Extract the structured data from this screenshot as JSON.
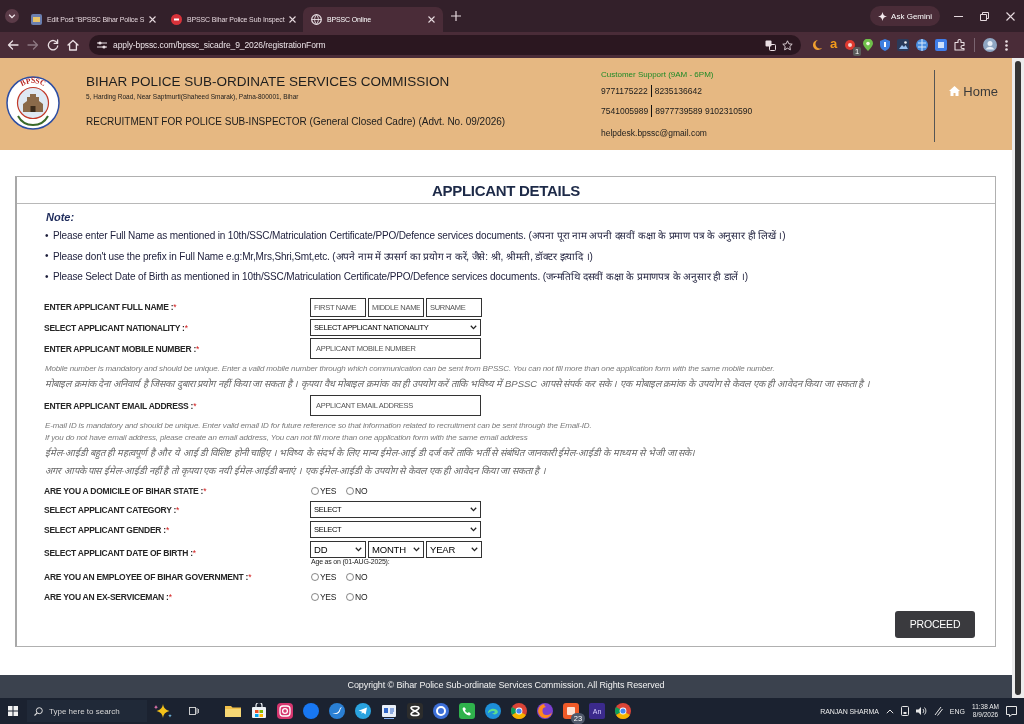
{
  "browser": {
    "tabs": [
      {
        "title": "Edit Post “BPSSC Bihar Police S",
        "selected": false
      },
      {
        "title": "BPSSC Bihar Police Sub Inspect",
        "selected": false
      },
      {
        "title": "BPSSC Online",
        "selected": true
      }
    ],
    "ask_gemini": "Ask Gemini",
    "url": "apply-bpssc.com/bpssc_sicadre_9_2026/registrationForm",
    "extension_letter": "a",
    "extension_badge": "1"
  },
  "header": {
    "logo_text": "BPSSC",
    "org_name": "BIHAR POLICE SUB-ORDINATE SERVICES COMMISSION",
    "address": "5, Harding Road, Near Saptmurti(Shaheed Smarak), Patna-800001, Bihar",
    "recruitment": "RECRUITMENT FOR POLICE SUB-INSPECTOR (General Closed Cadre) (Advt. No. 09/2026)",
    "support_title": "Customer Support (9AM - 6PM)",
    "phone_lines": [
      [
        "9771175222",
        "8235136642"
      ],
      [
        "7541005989",
        "8977739589 9102310590"
      ]
    ],
    "email": "helpdesk.bpssc@gmail.com",
    "home_link": "Home"
  },
  "form": {
    "title": "APPLICANT DETAILS",
    "note_label": "Note:",
    "notes": [
      {
        "marker": "•",
        "text": "Please enter Full Name as mentioned in 10th/SSC/Matriculation Certificate/PPO/Defence services documents. (अपना पूरा नाम अपनी दसवीं कक्षा के प्रमाण पत्र के अनुसार ही लिखें ।)"
      },
      {
        "marker": "•",
        "text": "Please don't use the prefix in Full Name e.g:Mr,Mrs,Shri,Smt,etc. (अपने नाम में उपसर्ग का प्रयोग न करें, जैसे: श्री, श्रीमती, डॉक्टर इत्यादि ।)"
      },
      {
        "marker": "•",
        "text": "Please Select Date of Birth as mentioned in 10th/SSC/Matriculation Certificate/PPO/Defence services documents. (जन्मतिथि दसवीं कक्षा के प्रमाणपत्र के अनुसार ही डालें ।)"
      }
    ],
    "fields": [
      {
        "kind": "name",
        "label": "ENTER APPLICANT FULL NAME :",
        "required_mark": "*",
        "inputs": [
          {
            "placeholder": "FIRST NAME"
          },
          {
            "placeholder": "MIDDLE NAME"
          },
          {
            "placeholder": "SURNAME"
          }
        ]
      },
      {
        "kind": "select",
        "label": "SELECT APPLICANT NATIONALITY :",
        "required_mark": "*",
        "selects": [
          {
            "value": "SELECT APPLICANT NATIONALITY"
          }
        ]
      },
      {
        "kind": "input",
        "label": "ENTER APPLICANT MOBILE NUMBER :",
        "required_mark": "*",
        "inputs": [
          {
            "placeholder": "APPLICANT MOBILE NUMBER"
          }
        ],
        "hints": [
          {
            "kind": "english",
            "text": "Mobile number is mandatory and should be unique. Enter a valid mobile number through which communication can be sent from BPSSC. You can not fill more than one application form with the same mobile number."
          },
          {
            "kind": "hindi",
            "text": "मोबाइल क्रमांक देना अनिवार्य है जिसका दुबारा प्रयोग नहीं किया जा सकता है । कृपया वैध मोबाइल क्रमांक का ही उपयोग करें ताकि भविष्य में BPSSC आपसे संपर्क कर सके । एक मोबाइल क्रमांक के उपयोग से केवल एक ही आवेदन किया जा सकता है ।"
          }
        ]
      },
      {
        "kind": "input",
        "label": "ENTER APPLICANT EMAIL ADDRESS :",
        "required_mark": "*",
        "inputs": [
          {
            "placeholder": "APPLICANT EMAIL ADDRESS"
          }
        ],
        "hints": [
          {
            "kind": "english",
            "text": "E-mail ID is mandatory and should be unique. Enter valid email ID for future reference so that information related to recruitment can be sent through the Email-ID."
          },
          {
            "kind": "english",
            "text": "If you do not have email address, please create an email address, You can not fill more than one application form with the same email address"
          },
          {
            "kind": "hindi",
            "text": "ईमेल-आईडी बहुत ही महत्वपूर्ण है और ये आई डी विशिष्ट होनी चाहिए । भविष्य के संदर्भ के लिए मान्य ईमेल-आई डी दर्ज करें ताकि भर्ती से संबंधित जानकारी ईमेल-आईडी के माध्यम से भेजी जा सके।"
          },
          {
            "kind": "hindi",
            "text": "अगर आपके पास ईमेल-आईडी नहीं है तो कृपया एक नयी ईमेल-आईडी बनाएं । एक ईमेल-आईडी के उपयोग से केवल एक ही आवेदन किया जा सकता है ।"
          }
        ]
      },
      {
        "kind": "radio",
        "label": "ARE YOU A DOMICILE OF BIHAR STATE :",
        "required_mark": "*",
        "options": [
          {
            "label": "YES",
            "selected": false
          },
          {
            "label": "NO",
            "selected": false
          }
        ]
      },
      {
        "kind": "select",
        "label": "SELECT APPLICANT CATEGORY :",
        "required_mark": "*",
        "selects": [
          {
            "value": "SELECT"
          }
        ]
      },
      {
        "kind": "select",
        "label": "SELECT APPLICANT GENDER :",
        "required_mark": "*",
        "selects": [
          {
            "value": "SELECT"
          }
        ]
      },
      {
        "kind": "date",
        "label": "SELECT APPLICANT DATE OF BIRTH :",
        "required_mark": "*",
        "selects": [
          {
            "value": "DD"
          },
          {
            "value": "MONTH"
          },
          {
            "value": "YEAR"
          }
        ],
        "note": "Age as on (01-AUG-2025):"
      },
      {
        "kind": "radio",
        "label": "ARE YOU AN EMPLOYEE OF BIHAR GOVERNMENT :",
        "required_mark": "*",
        "options": [
          {
            "label": "YES",
            "selected": false
          },
          {
            "label": "NO",
            "selected": false
          }
        ]
      },
      {
        "kind": "radio",
        "label": "ARE YOU AN EX-SERVICEMAN :",
        "required_mark": "*",
        "options": [
          {
            "label": "YES",
            "selected": false
          },
          {
            "label": "NO",
            "selected": false
          }
        ]
      }
    ],
    "button": "PROCEED"
  },
  "footer": {
    "copyright": "Copyright © Bihar Police Sub-ordinate Services Commission. All Rights Reserved"
  },
  "taskbar": {
    "search_placeholder": "Type here to search",
    "app_badge": "23",
    "app_label": "An",
    "user": "RANJAN SHARMA",
    "language": "ENG",
    "time": "11:38 AM",
    "date": "8/9/2026"
  }
}
